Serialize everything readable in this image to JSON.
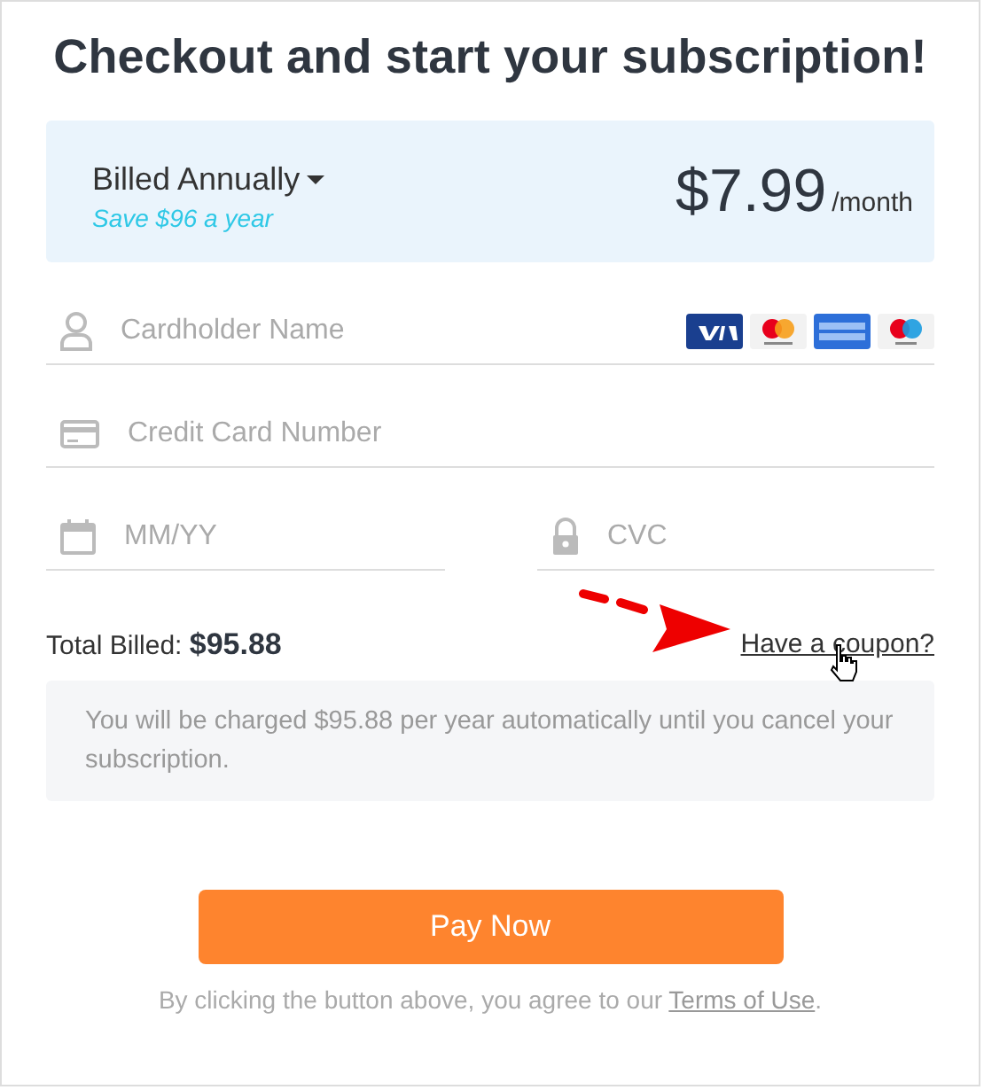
{
  "title": "Checkout and start your subscription!",
  "plan": {
    "label": "Billed Annually",
    "savings": "Save $96 a year",
    "price": "$7.99",
    "period": "/month"
  },
  "fields": [
    {
      "kind": "person",
      "placeholder": "Cardholder Name"
    },
    {
      "kind": "card",
      "placeholder": "Credit Card Number"
    },
    {
      "kind": "calendar",
      "placeholder": "MM/YY"
    },
    {
      "kind": "lock",
      "placeholder": "CVC"
    }
  ],
  "total": {
    "label": "Total Billed:",
    "amount": "$95.88"
  },
  "coupon_link": "Have a coupon?",
  "notice": "You will be charged $95.88 per year automatically until you cancel your subscription.",
  "button": "Pay Now",
  "terms": {
    "text": "By clicking the button above, you agree to our",
    "link": "Terms of Use",
    "suffix": "."
  }
}
